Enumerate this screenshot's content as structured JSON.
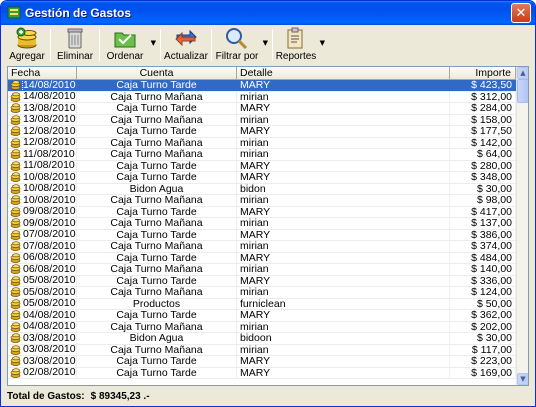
{
  "window": {
    "title": "Gestión de Gastos",
    "close_glyph": "✕"
  },
  "toolbar": {
    "agregar": "Agregar",
    "eliminar": "Eliminar",
    "ordenar": "Ordenar",
    "actualizar": "Actualizar",
    "filtrar": "Filtrar por",
    "reportes": "Reportes",
    "dropdown_glyph": "▼"
  },
  "table": {
    "headers": {
      "fecha": "Fecha",
      "cuenta": "Cuenta",
      "detalle": "Detalle",
      "importe": "Importe"
    },
    "rows": [
      {
        "fecha": "14/08/2010",
        "cuenta": "Caja Turno Tarde",
        "detalle": "MARY",
        "importe": "$ 423,50"
      },
      {
        "fecha": "14/08/2010",
        "cuenta": "Caja Turno Mañana",
        "detalle": "mirian",
        "importe": "$ 312,00"
      },
      {
        "fecha": "13/08/2010",
        "cuenta": "Caja Turno Tarde",
        "detalle": "MARY",
        "importe": "$ 284,00"
      },
      {
        "fecha": "13/08/2010",
        "cuenta": "Caja Turno Mañana",
        "detalle": "mirian",
        "importe": "$ 158,00"
      },
      {
        "fecha": "12/08/2010",
        "cuenta": "Caja Turno Tarde",
        "detalle": "MARY",
        "importe": "$ 177,50"
      },
      {
        "fecha": "12/08/2010",
        "cuenta": "Caja Turno Mañana",
        "detalle": "mirian",
        "importe": "$ 142,00"
      },
      {
        "fecha": "11/08/2010",
        "cuenta": "Caja Turno Mañana",
        "detalle": "mirian",
        "importe": "$ 64,00"
      },
      {
        "fecha": "11/08/2010",
        "cuenta": "Caja Turno Tarde",
        "detalle": "MARY",
        "importe": "$ 280,00"
      },
      {
        "fecha": "10/08/2010",
        "cuenta": "Caja Turno Tarde",
        "detalle": "MARY",
        "importe": "$ 348,00"
      },
      {
        "fecha": "10/08/2010",
        "cuenta": "Bidon Agua",
        "detalle": "bidon",
        "importe": "$ 30,00"
      },
      {
        "fecha": "10/08/2010",
        "cuenta": "Caja Turno Mañana",
        "detalle": "mirian",
        "importe": "$ 98,00"
      },
      {
        "fecha": "09/08/2010",
        "cuenta": "Caja Turno Tarde",
        "detalle": "MARY",
        "importe": "$ 417,00"
      },
      {
        "fecha": "09/08/2010",
        "cuenta": "Caja Turno Mañana",
        "detalle": "mirian",
        "importe": "$ 137,00"
      },
      {
        "fecha": "07/08/2010",
        "cuenta": "Caja Turno Tarde",
        "detalle": "MARY",
        "importe": "$ 386,00"
      },
      {
        "fecha": "07/08/2010",
        "cuenta": "Caja Turno Mañana",
        "detalle": "mirian",
        "importe": "$ 374,00"
      },
      {
        "fecha": "06/08/2010",
        "cuenta": "Caja Turno Tarde",
        "detalle": "MARY",
        "importe": "$ 484,00"
      },
      {
        "fecha": "06/08/2010",
        "cuenta": "Caja Turno Mañana",
        "detalle": "mirian",
        "importe": "$ 140,00"
      },
      {
        "fecha": "05/08/2010",
        "cuenta": "Caja Turno Tarde",
        "detalle": "MARY",
        "importe": "$ 336,00"
      },
      {
        "fecha": "05/08/2010",
        "cuenta": "Caja Turno Mañana",
        "detalle": "mirian",
        "importe": "$ 124,00"
      },
      {
        "fecha": "05/08/2010",
        "cuenta": "Productos",
        "detalle": "furniclean",
        "importe": "$ 50,00"
      },
      {
        "fecha": "04/08/2010",
        "cuenta": "Caja Turno Tarde",
        "detalle": "MARY",
        "importe": "$ 362,00"
      },
      {
        "fecha": "04/08/2010",
        "cuenta": "Caja Turno Mañana",
        "detalle": "mirian",
        "importe": "$ 202,00"
      },
      {
        "fecha": "03/08/2010",
        "cuenta": "Bidon Agua",
        "detalle": "bidoon",
        "importe": "$ 30,00"
      },
      {
        "fecha": "03/08/2010",
        "cuenta": "Caja Turno Mañana",
        "detalle": "mirian",
        "importe": "$ 117,00"
      },
      {
        "fecha": "03/08/2010",
        "cuenta": "Caja Turno Tarde",
        "detalle": "MARY",
        "importe": "$ 223,00"
      },
      {
        "fecha": "02/08/2010",
        "cuenta": "Caja Turno Tarde",
        "detalle": "MARY",
        "importe": "$ 169,00"
      }
    ],
    "selected_row": 0,
    "row_icon": "coins-icon"
  },
  "scrollbar": {
    "up_glyph": "▲",
    "down_glyph": "▼"
  },
  "status": {
    "label": "Total de Gastos:",
    "value": "$ 89345,23 .-"
  },
  "colors": {
    "titlebar": "#0053ee",
    "selection": "#316ac5",
    "window_bg": "#ece9d8",
    "close": "#c63c18"
  }
}
